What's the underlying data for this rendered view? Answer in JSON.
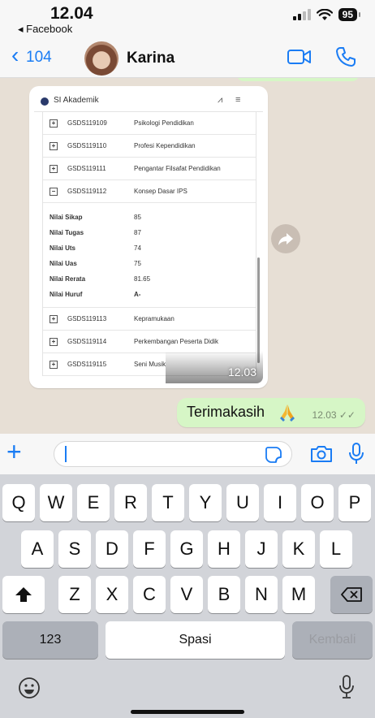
{
  "status_bar": {
    "time": "12.04",
    "back_app": "◂ Facebook",
    "battery": "95"
  },
  "chat_header": {
    "back_count": "104",
    "contact_name": "Karina"
  },
  "shared_image": {
    "app_title": "SI Akademik",
    "courses_top": [
      {
        "code": "GSDS119109",
        "name": "Psikologi Pendidikan",
        "state": "+"
      },
      {
        "code": "GSDS119110",
        "name": "Profesi Kependidikan",
        "state": "+"
      },
      {
        "code": "GSDS119111",
        "name": "Pengantar Filsafat Pendidikan",
        "state": "+"
      },
      {
        "code": "GSDS119112",
        "name": "Konsep Dasar IPS",
        "state": "−"
      }
    ],
    "grades": [
      {
        "label": "Nilai Sikap",
        "value": "85"
      },
      {
        "label": "Nilai Tugas",
        "value": "87"
      },
      {
        "label": "Nilai Uts",
        "value": "74"
      },
      {
        "label": "Nilai Uas",
        "value": "75"
      },
      {
        "label": "Nilai Rerata",
        "value": "81.65"
      },
      {
        "label": "Nilai Huruf",
        "value": "A-"
      }
    ],
    "courses_bottom": [
      {
        "code": "GSDS119113",
        "name": "Kepramukaan",
        "state": "+"
      },
      {
        "code": "GSDS119114",
        "name": "Perkembangan Peserta Didik",
        "state": "+"
      },
      {
        "code": "GSDS119115",
        "name": "Seni Musik",
        "state": "+"
      }
    ],
    "timestamp": "12.03"
  },
  "outgoing_message": {
    "text": "Terimakasih",
    "emoji": "folded-hands",
    "timestamp": "12.03 ✓✓"
  },
  "input": {
    "placeholder": "",
    "value": ""
  },
  "keyboard": {
    "row1": [
      "Q",
      "W",
      "E",
      "R",
      "T",
      "Y",
      "U",
      "I",
      "O",
      "P"
    ],
    "row2": [
      "A",
      "S",
      "D",
      "F",
      "G",
      "H",
      "J",
      "K",
      "L"
    ],
    "row3": [
      "Z",
      "X",
      "C",
      "V",
      "B",
      "N",
      "M"
    ],
    "numbers_key": "123",
    "space_key": "Spasi",
    "return_key": "Kembali"
  },
  "colors": {
    "accent": "#1a7cf4",
    "outgoing_bubble": "#d6f6c6",
    "chat_background": "#e7dfd5",
    "keyboard_background": "#d2d4d9"
  }
}
